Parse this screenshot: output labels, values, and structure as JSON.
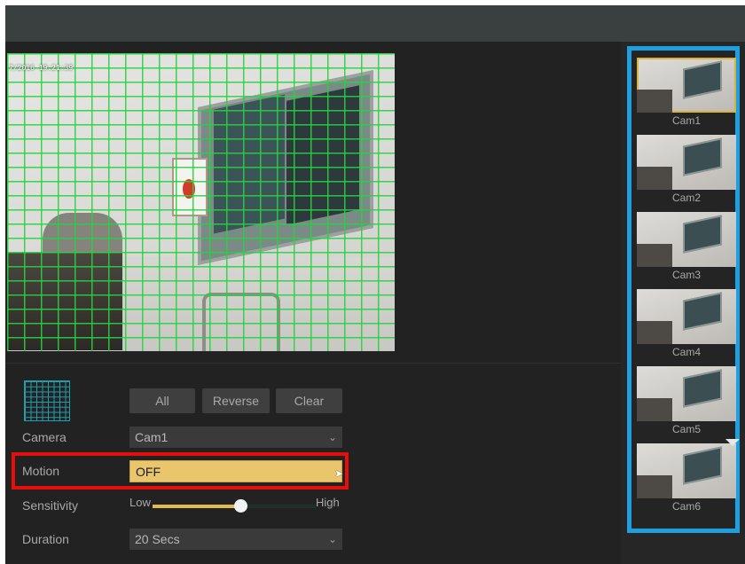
{
  "video": {
    "timestamp": "7/2016 19:21:39"
  },
  "region_buttons": {
    "all": "All",
    "reverse": "Reverse",
    "clear": "Clear"
  },
  "settings": {
    "camera_label": "Camera",
    "camera_value": "Cam1",
    "motion_label": "Motion",
    "motion_value": "OFF",
    "sensitivity_label": "Sensitivity",
    "sensitivity_low": "Low",
    "sensitivity_high": "High",
    "sensitivity_level": 0.54,
    "duration_label": "Duration",
    "duration_value": "20 Secs"
  },
  "cameras": [
    {
      "label": "Cam1",
      "selected": true
    },
    {
      "label": "Cam2",
      "selected": false
    },
    {
      "label": "Cam3",
      "selected": false
    },
    {
      "label": "Cam4",
      "selected": false
    },
    {
      "label": "Cam5",
      "selected": false
    },
    {
      "label": "Cam6",
      "selected": false
    }
  ],
  "colors": {
    "highlight_red": "#e80d0d",
    "list_border_blue": "#1e9fe0",
    "grid_green": "#28d23c",
    "motion_field": "#e9c66c",
    "slider_fill": "#e2bb4f"
  }
}
